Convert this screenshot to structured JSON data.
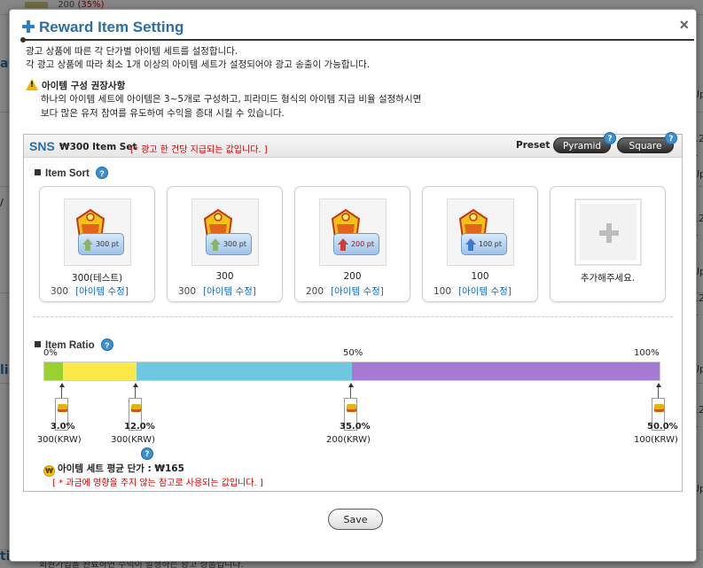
{
  "background": {
    "top_value": "200",
    "top_pct": "(35%)",
    "left_fragments": [
      "at",
      "/",
      "li",
      "tion"
    ],
    "right_fragments": [
      "Up",
      "12",
      "1",
      "Up",
      "12",
      "1",
      "Up",
      "12",
      "1",
      "Up",
      "12",
      "1",
      "Up"
    ],
    "bottom_text": "회원가입을 완료하면 수익이 발생하는 광고 상품입니다."
  },
  "dialog": {
    "title": "Reward Item Setting",
    "close_label": "×",
    "intro_lines": [
      "광고 상품에 따른 각 단가별 아이템 세트를 설정합니다.",
      "각 광고 상품에 따라 최소 1개 이상의 아이템 세트가 설정되어야 광고 송출이 가능합니다."
    ],
    "recommend_title": "아이템 구성 권장사항",
    "recommend_lines": [
      "하나의 아이템 세트에 아이템은 3~5개로 구성하고, 피라미드 형식의 아이템 지급 비율 설정하시면",
      "보다 많은 유저 참여를 유도하여 수익을 증대 시킬 수 있습니다."
    ],
    "save_label": "Save"
  },
  "panel": {
    "product": "SNS",
    "item_set": "₩300 Item Set",
    "item_set_note": "[* 광고 한 건당 지급되는 값입니다. ]",
    "preset_label": "Preset :",
    "presets": [
      "Pyramid",
      "Square"
    ],
    "help": "?",
    "item_sort_label": "Item Sort",
    "item_ratio_label": "Item Ratio",
    "edit_label": "[아이템 수정]",
    "items": [
      {
        "name": "300(테스트)",
        "price": "300",
        "pt": "300 pt",
        "arrow": "green"
      },
      {
        "name": "300",
        "price": "300",
        "pt": "300 pt",
        "arrow": "green"
      },
      {
        "name": "200",
        "price": "200",
        "pt": "200 pt",
        "arrow": "red"
      },
      {
        "name": "100",
        "price": "100",
        "pt": "100 pt",
        "arrow": "blue"
      }
    ],
    "add_label": "추가해주세요.",
    "ratio_ticks": [
      "0%",
      "50%",
      "100%"
    ],
    "ratio_segments": [
      {
        "value": 3.0,
        "color": "#9bd033"
      },
      {
        "value": 12.0,
        "color": "#fde84a"
      },
      {
        "value": 35.0,
        "color": "#6ec9e0"
      },
      {
        "value": 50.0,
        "color": "#a57ad3"
      }
    ],
    "markers": [
      {
        "pct": "3.0%",
        "krw": "300(KRW)"
      },
      {
        "pct": "12.0%",
        "krw": "300(KRW)"
      },
      {
        "pct": "35.0%",
        "krw": "200(KRW)"
      },
      {
        "pct": "50.0%",
        "krw": "100(KRW)"
      }
    ],
    "avg_label": "아이템 세트 평균 단가 : ₩165",
    "avg_note": "[ * 과금에 영향을 주지 않는 참고로 사용되는 값입니다. ]",
    "won_icon": "₩"
  }
}
